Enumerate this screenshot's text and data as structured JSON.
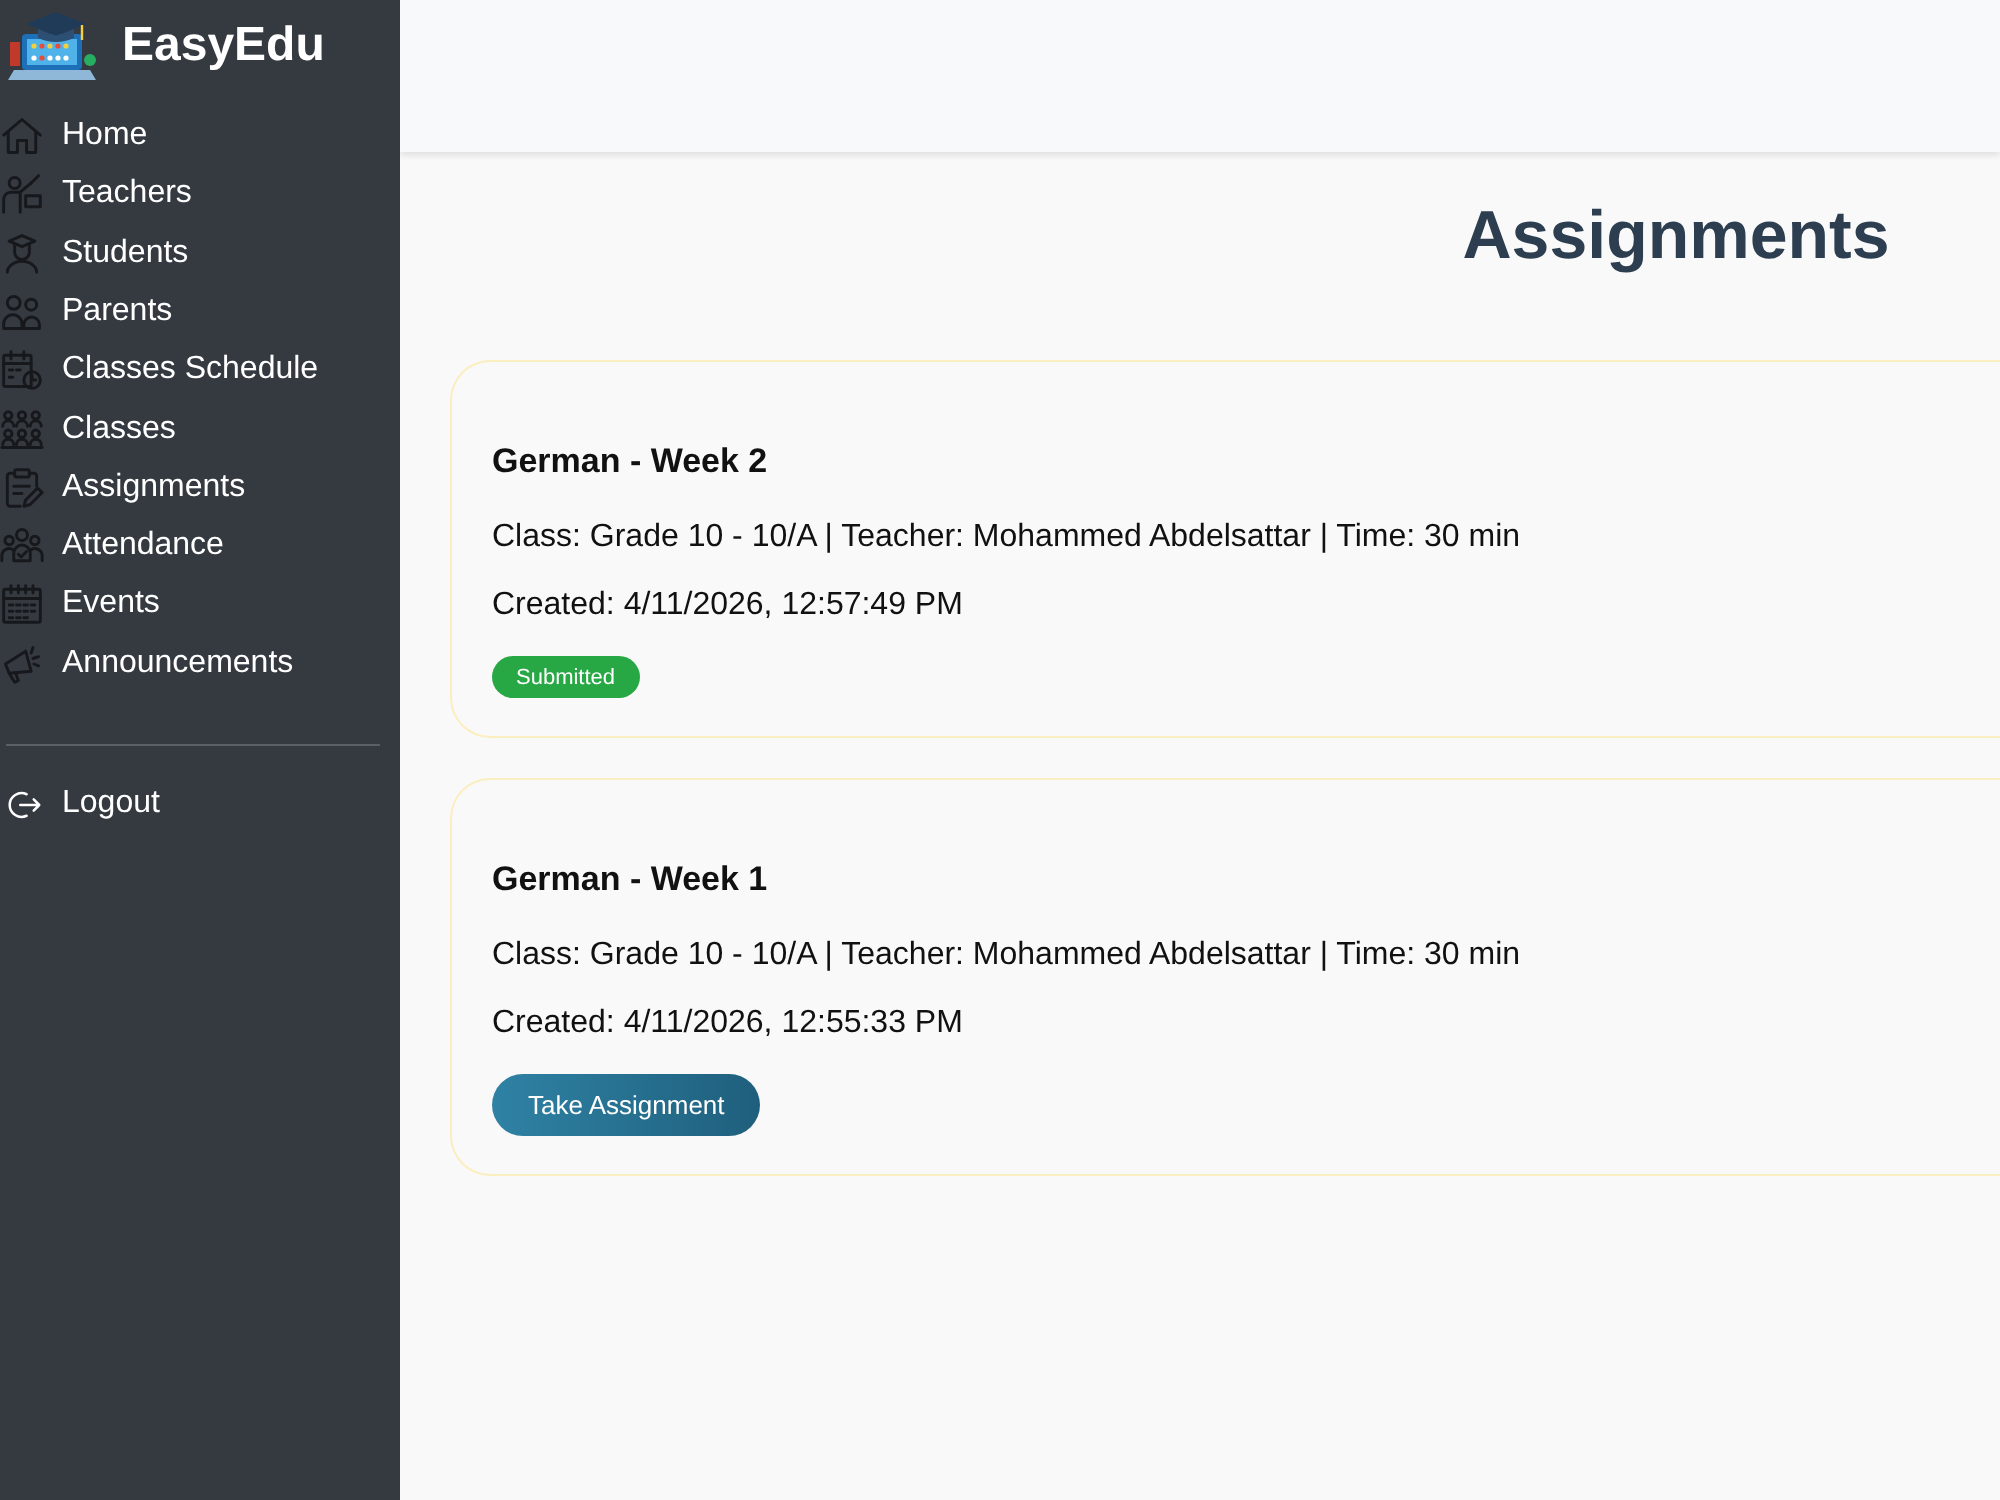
{
  "brand": {
    "name": "EasyEdu"
  },
  "sidebar": {
    "items": [
      {
        "label": "Home"
      },
      {
        "label": "Teachers"
      },
      {
        "label": "Students"
      },
      {
        "label": "Parents"
      },
      {
        "label": "Classes Schedule"
      },
      {
        "label": "Classes"
      },
      {
        "label": "Assignments"
      },
      {
        "label": "Attendance"
      },
      {
        "label": "Events"
      },
      {
        "label": "Announcements"
      }
    ],
    "footer_items": [
      {
        "label": "Logout"
      }
    ]
  },
  "page": {
    "title": "Assignments"
  },
  "assignments": [
    {
      "title": "German - Week 2",
      "details": "Class: Grade 10 - 10/A | Teacher: Mohammed Abdelsattar | Time: 30 min",
      "created": "Created: 4/11/2026, 12:57:49 PM",
      "action": {
        "kind": "status",
        "label": "Submitted"
      }
    },
    {
      "title": "German - Week 1",
      "details": "Class: Grade 10 - 10/A | Teacher: Mohammed Abdelsattar | Time: 30 min",
      "created": "Created: 4/11/2026, 12:55:33 PM",
      "action": {
        "kind": "button",
        "label": "Take Assignment"
      }
    }
  ]
}
